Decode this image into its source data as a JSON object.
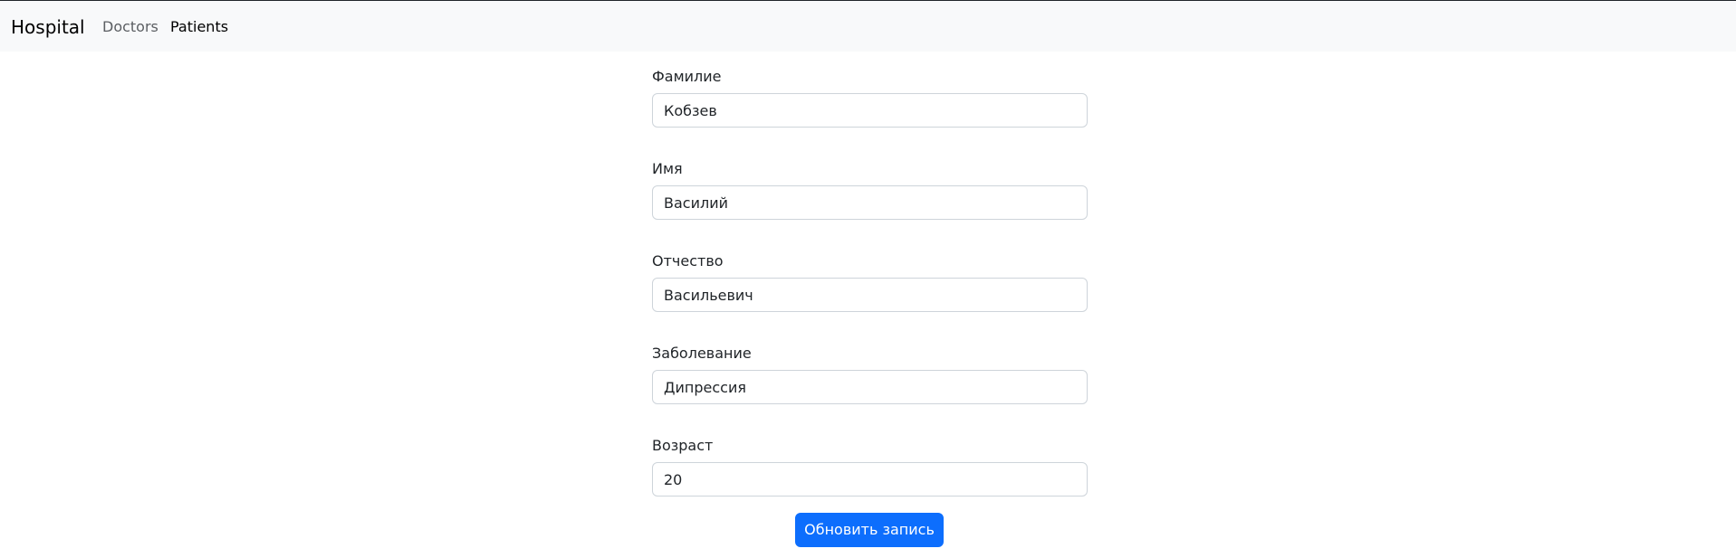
{
  "navbar": {
    "brand": "Hospital",
    "links": [
      {
        "label": "Doctors",
        "active": false
      },
      {
        "label": "Patients",
        "active": true
      }
    ]
  },
  "form": {
    "fields": [
      {
        "label": "Фамилие",
        "value": "Кобзев"
      },
      {
        "label": "Имя",
        "value": "Василий"
      },
      {
        "label": "Отчество",
        "value": "Васильевич"
      },
      {
        "label": "Заболевание",
        "value": "Дипрессия"
      },
      {
        "label": "Возраст",
        "value": "20"
      }
    ],
    "submit_label": "Обновить запись"
  },
  "colors": {
    "navbar_bg": "#f8f9fa",
    "primary": "#0d6efd",
    "input_border": "#ced4da"
  }
}
